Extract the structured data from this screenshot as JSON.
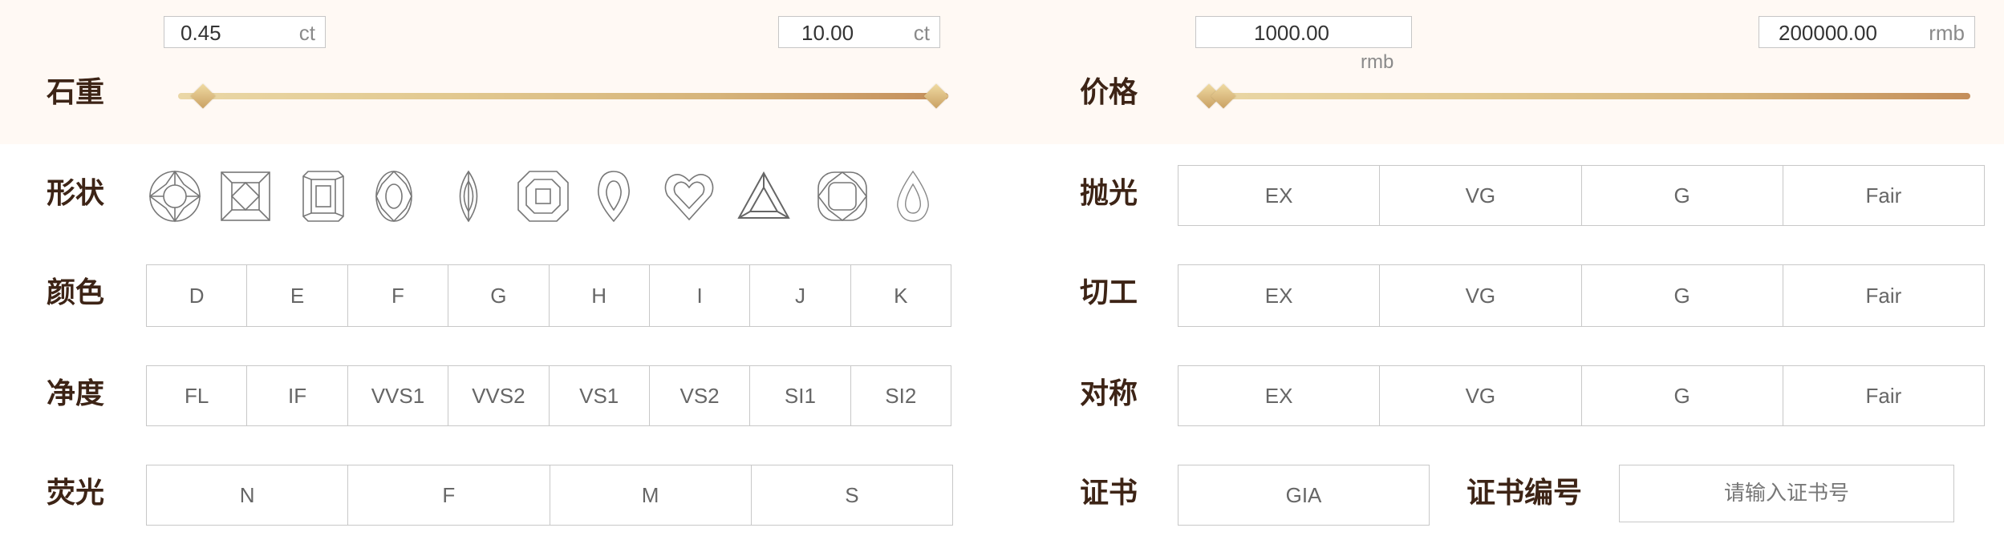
{
  "weight": {
    "label": "石重",
    "min": {
      "value": "0.45",
      "unit": "ct"
    },
    "max": {
      "value": "10.00",
      "unit": "ct"
    }
  },
  "price": {
    "label": "价格",
    "min": {
      "value": "1000.00",
      "unit": "rmb"
    },
    "max": {
      "value": "200000.00",
      "unit": "rmb"
    }
  },
  "shape": {
    "label": "形状",
    "icons": [
      "round-diamond-icon",
      "princess-diamond-icon",
      "emerald-diamond-icon",
      "oval-diamond-icon",
      "marquise-diamond-icon",
      "asscher-diamond-icon",
      "pear-diamond-icon",
      "heart-diamond-icon",
      "trillion-diamond-icon",
      "cushion-diamond-icon",
      "pear-small-diamond-icon"
    ]
  },
  "color": {
    "label": "颜色",
    "options": [
      "D",
      "E",
      "F",
      "G",
      "H",
      "I",
      "J",
      "K"
    ]
  },
  "clarity": {
    "label": "净度",
    "options": [
      "FL",
      "IF",
      "VVS1",
      "VVS2",
      "VS1",
      "VS2",
      "SI1",
      "SI2"
    ]
  },
  "fluorescence": {
    "label": "荧光",
    "options": [
      "N",
      "F",
      "M",
      "S"
    ]
  },
  "polish": {
    "label": "抛光",
    "options": [
      "EX",
      "VG",
      "G",
      "Fair"
    ]
  },
  "cut": {
    "label": "切工",
    "options": [
      "EX",
      "VG",
      "G",
      "Fair"
    ]
  },
  "symmetry": {
    "label": "对称",
    "options": [
      "EX",
      "VG",
      "G",
      "Fair"
    ]
  },
  "certificate": {
    "label": "证书",
    "value": "GIA",
    "number_label": "证书编号",
    "number_placeholder": "请输入证书号"
  },
  "colors": {
    "label": "#3d2416",
    "border": "#c8c8c8",
    "gold_light": "#ead7a6",
    "gold_dark": "#c48e5a"
  }
}
